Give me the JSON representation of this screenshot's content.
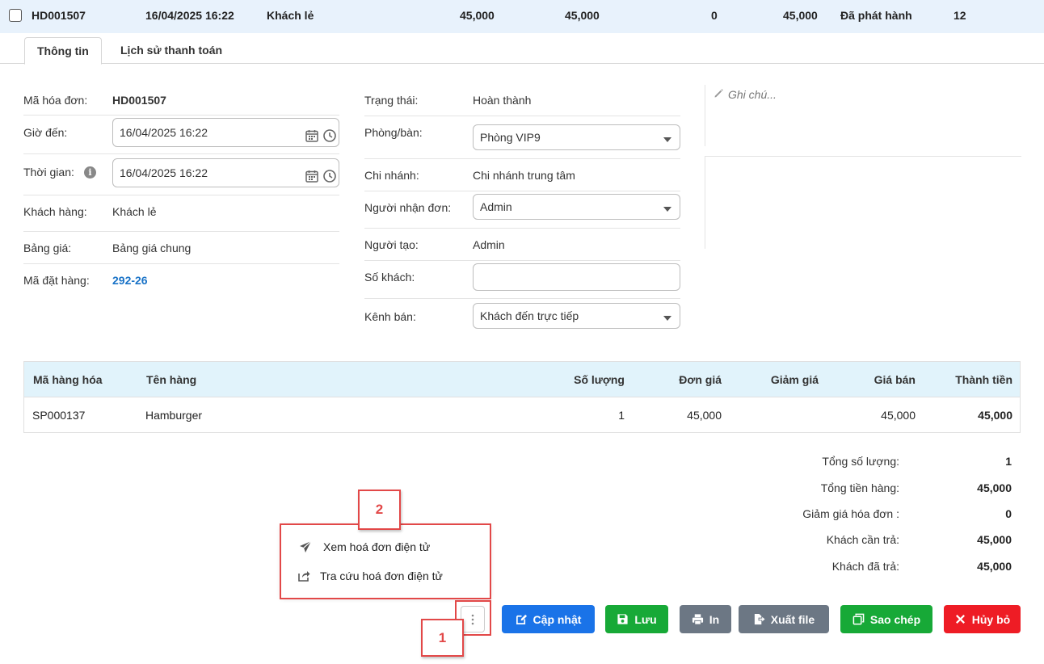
{
  "invoice_row": {
    "code": "HD001507",
    "datetime": "16/04/2025 16:22",
    "customer": "Khách lẻ",
    "total": "45,000",
    "after_discount": "45,000",
    "discount": "0",
    "paid": "45,000",
    "status": "Đã phát hành",
    "count": "12"
  },
  "tabs": [
    {
      "label": "Thông tin"
    },
    {
      "label": "Lịch sử thanh toán"
    }
  ],
  "left_form": {
    "invoice_code_label": "Mã hóa đơn:",
    "invoice_code": "HD001507",
    "arrival_label": "Giờ đến:",
    "arrival_value": "16/04/2025 16:22",
    "time_label": "Thời gian:",
    "time_value": "16/04/2025 16:22",
    "customer_label": "Khách hàng:",
    "customer_value": "Khách lẻ",
    "pricelist_label": "Bảng giá:",
    "pricelist_value": "Bảng giá chung",
    "order_label": "Mã đặt hàng:",
    "order_value": "292-26"
  },
  "mid_form": {
    "status_label": "Trạng thái:",
    "status_value": "Hoàn thành",
    "room_label": "Phòng/bàn:",
    "room_value": "Phòng VIP9",
    "branch_label": "Chi nhánh:",
    "branch_value": "Chi nhánh trung tâm",
    "receiver_label": "Người nhận đơn:",
    "receiver_value": "Admin",
    "creator_label": "Người tạo:",
    "creator_value": "Admin",
    "guests_label": "Số khách:",
    "guests_value": "",
    "channel_label": "Kênh bán:",
    "channel_value": "Khách đến trực tiếp"
  },
  "note": {
    "placeholder": "Ghi chú..."
  },
  "table": {
    "headers": [
      "Mã hàng hóa",
      "Tên hàng",
      "Số lượng",
      "Đơn giá",
      "Giảm giá",
      "Giá bán",
      "Thành tiền"
    ],
    "rows": [
      [
        "SP000137",
        "Hamburger",
        "1",
        "45,000",
        "",
        "45,000",
        "45,000"
      ]
    ]
  },
  "totals": [
    {
      "label": "Tổng số lượng:",
      "value": "1"
    },
    {
      "label": "Tổng tiền hàng:",
      "value": "45,000"
    },
    {
      "label": "Giảm giá hóa đơn :",
      "value": "0"
    },
    {
      "label": "Khách cần trả:",
      "value": "45,000"
    },
    {
      "label": "Khách đã trả:",
      "value": "45,000"
    }
  ],
  "menu": {
    "view_einvoice": "Xem hoá đơn điện tử",
    "lookup_einvoice": "Tra cứu hoá đơn điện tử"
  },
  "buttons": {
    "update": "Cập nhật",
    "save": "Lưu",
    "print": "In",
    "export": "Xuất file",
    "copy": "Sao chép",
    "cancel": "Hủy bỏ"
  },
  "callouts": {
    "one": "1",
    "two": "2"
  },
  "colors": {
    "update": "#1a73e8",
    "save": "#17a937",
    "print": "#6c7784",
    "export": "#6c7784",
    "copy": "#17a937",
    "cancel": "#ee1c25",
    "callout": "#e24848"
  }
}
